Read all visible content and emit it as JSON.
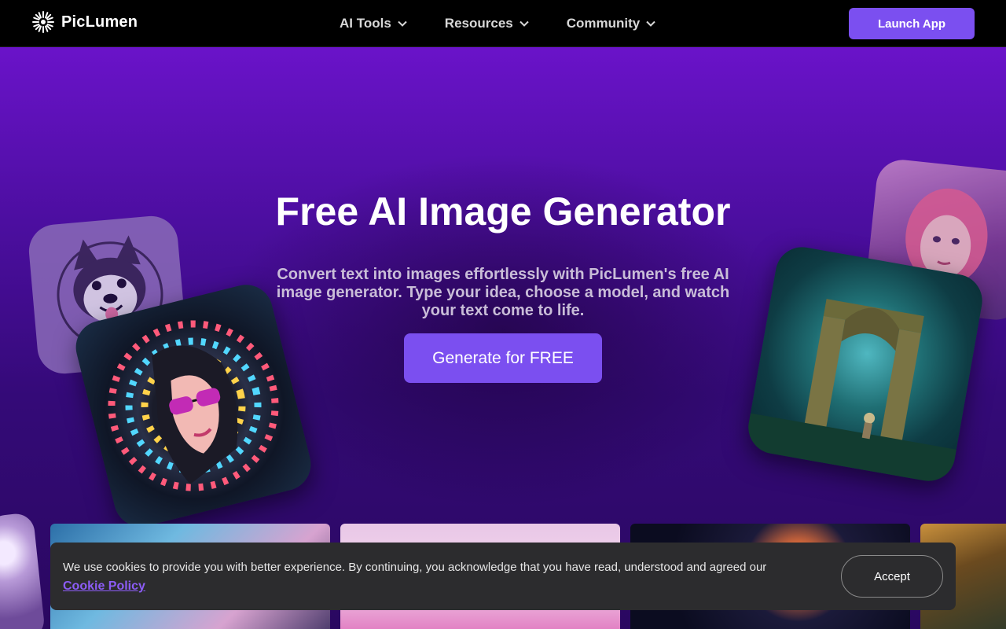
{
  "header": {
    "brand": "PicLumen",
    "logo_icon": "sunburst-icon",
    "nav": [
      {
        "label": "AI Tools",
        "icon": "chevron-down-icon"
      },
      {
        "label": "Resources",
        "icon": "chevron-down-icon"
      },
      {
        "label": "Community",
        "icon": "chevron-down-icon"
      }
    ],
    "launch_label": "Launch App"
  },
  "hero": {
    "title": "Free AI Image Generator",
    "description": "Convert text into images effortlessly with PicLumen's free AI image generator. Type your idea, choose a model, and watch your text come to life.",
    "cta_label": "Generate for FREE"
  },
  "cookie": {
    "text": "We use cookies to provide you with better experience. By continuing, you acknowledge that you have read, understood and agreed our ",
    "link_label": "Cookie Policy",
    "accept_label": "Accept"
  },
  "colors": {
    "accent": "#7b4ff0",
    "nav_bg": "#000000",
    "hero_top": "#6a13c9",
    "hero_bottom": "#2a0860",
    "cookie_bg": "#2c2c2e",
    "link": "#8c5cf6"
  }
}
